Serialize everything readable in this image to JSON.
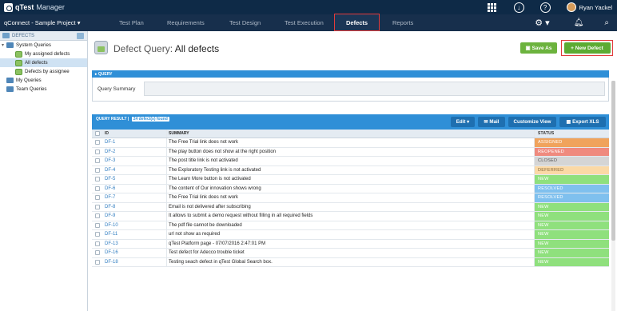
{
  "app": {
    "name": "qTest",
    "subtitle": "Manager",
    "user": "Ryan Yackel"
  },
  "project": "qConnect - Sample Project",
  "nav": {
    "tabs": [
      {
        "label": "Test Plan"
      },
      {
        "label": "Requirements"
      },
      {
        "label": "Test Design"
      },
      {
        "label": "Test Execution"
      },
      {
        "label": "Defects",
        "active": true
      },
      {
        "label": "Reports"
      }
    ]
  },
  "sidebar": {
    "header": "DEFECTS",
    "items": [
      {
        "label": "System Queries",
        "type": "folder",
        "level": 0
      },
      {
        "label": "My assigned defects",
        "type": "query",
        "level": 1
      },
      {
        "label": "All defects",
        "type": "query",
        "level": 1,
        "selected": true
      },
      {
        "label": "Defects by assignee",
        "type": "query",
        "level": 1
      },
      {
        "label": "My Queries",
        "type": "folder",
        "level": 0
      },
      {
        "label": "Team Queries",
        "type": "folder",
        "level": 0
      }
    ]
  },
  "page": {
    "title_prefix": "Defect Query:",
    "title_name": "All defects",
    "save_as": "Save As",
    "new_defect": "+ New Defect"
  },
  "query": {
    "header": "QUERY",
    "summary_label": "Query Summary",
    "summary_value": ""
  },
  "result": {
    "header": "QUERY RESULT",
    "count_text": "24 defect(s) found",
    "buttons": {
      "edit": "Edit",
      "mail": "Mail",
      "customize": "Customize View",
      "export": "Export XLS"
    },
    "columns": {
      "id": "ID",
      "summary": "SUMMARY",
      "status": "STATUS"
    },
    "rows": [
      {
        "id": "DF-1",
        "summary": "The Free Trial link does not work",
        "status": "ASSIGNED",
        "color": "#f0a35c"
      },
      {
        "id": "DF-2",
        "summary": "The play button does not show at the right position",
        "status": "REOPENED",
        "color": "#ef8a7e"
      },
      {
        "id": "DF-3",
        "summary": "The post title link is not activated",
        "status": "CLOSED",
        "color": "#d5d5d5"
      },
      {
        "id": "DF-4",
        "summary": "The Exploratory Testing link is not activated",
        "status": "DEFERRED",
        "color": "#fbd9a6"
      },
      {
        "id": "DF-5",
        "summary": "The Learn More button is not activated",
        "status": "NEW",
        "color": "#8fe07d"
      },
      {
        "id": "DF-6",
        "summary": "The content of Our innovation shows wrong",
        "status": "RESOLVED",
        "color": "#7fc0ee"
      },
      {
        "id": "DF-7",
        "summary": "The Free Trial link does not work",
        "status": "RESOLVED",
        "color": "#7fc0ee"
      },
      {
        "id": "DF-8",
        "summary": "Email is not delivered after subscribing",
        "status": "NEW",
        "color": "#8fe07d"
      },
      {
        "id": "DF-9",
        "summary": "It allows to submit a demo request without filling in all required fields",
        "status": "NEW",
        "color": "#8fe07d"
      },
      {
        "id": "DF-10",
        "summary": "The pdf file cannot be downloaded",
        "status": "NEW",
        "color": "#8fe07d"
      },
      {
        "id": "DF-11",
        "summary": "url not show as required",
        "status": "NEW",
        "color": "#8fe07d"
      },
      {
        "id": "DF-13",
        "summary": "qTest Platform page - 07/07/2016 2:47:01 PM",
        "status": "NEW",
        "color": "#8fe07d"
      },
      {
        "id": "DF-16",
        "summary": "Test defect for Adecco trouble ticket",
        "status": "NEW",
        "color": "#8fe07d"
      },
      {
        "id": "DF-18",
        "summary": "Testing seach defect in qTest Global Search box.",
        "status": "NEW",
        "color": "#8fe07d"
      }
    ]
  },
  "colors": {
    "topbar": "#0e2a47",
    "navbar": "#172f4c",
    "accent": "#2f8fd7",
    "green_button": "#5cab33",
    "highlight": "#e23b3b"
  }
}
